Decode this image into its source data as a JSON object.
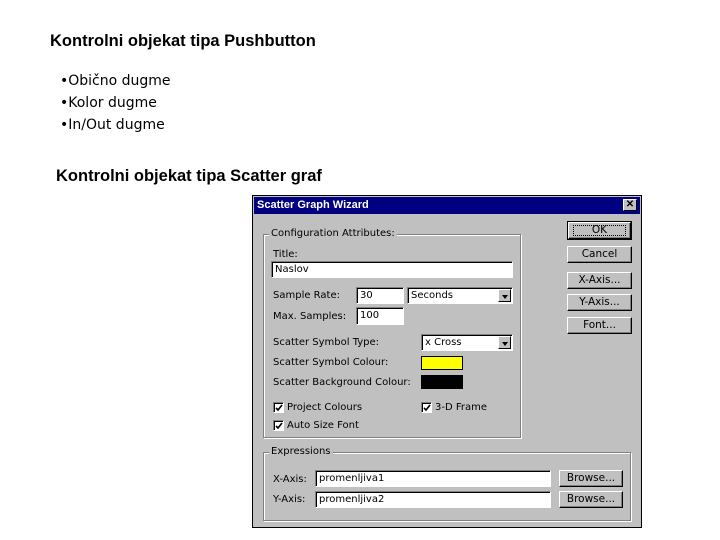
{
  "slide": {
    "heading1": "Kontrolni objekat tipa Pushbutton",
    "bullets": [
      "•Obično dugme",
      "•Kolor dugme",
      "•In/Out dugme"
    ],
    "heading2": "Kontrolni objekat tipa Scatter graf"
  },
  "dialog": {
    "title": "Scatter Graph Wizard",
    "close_glyph": "✕",
    "config_group": "Configuration Attributes:",
    "title_label": "Title:",
    "title_value": "Naslov",
    "sample_rate_label": "Sample Rate:",
    "sample_rate_value": "30",
    "sample_rate_unit": "Seconds",
    "max_samples_label": "Max. Samples:",
    "max_samples_value": "100",
    "symbol_type_label": "Scatter Symbol Type:",
    "symbol_type_value": "x  Cross",
    "symbol_colour_label": "Scatter Symbol Colour:",
    "symbol_colour": "#ffff00",
    "bg_colour_label": "Scatter Background Colour:",
    "bg_colour": "#000000",
    "project_colours_label": "Project Colours",
    "project_colours_checked": true,
    "auto_size_font_label": "Auto Size Font",
    "auto_size_font_checked": true,
    "frame_3d_label": "3-D Frame",
    "frame_3d_checked": true,
    "buttons": {
      "ok": "OK",
      "cancel": "Cancel",
      "x_axis": "X-Axis...",
      "y_axis": "Y-Axis...",
      "font": "Font..."
    },
    "expressions_group": "Expressions",
    "x_axis_label": "X-Axis:",
    "x_axis_value": "promenljiva1",
    "y_axis_label": "Y-Axis:",
    "y_axis_value": "promenljiva2",
    "browse_label": "Browse..."
  }
}
